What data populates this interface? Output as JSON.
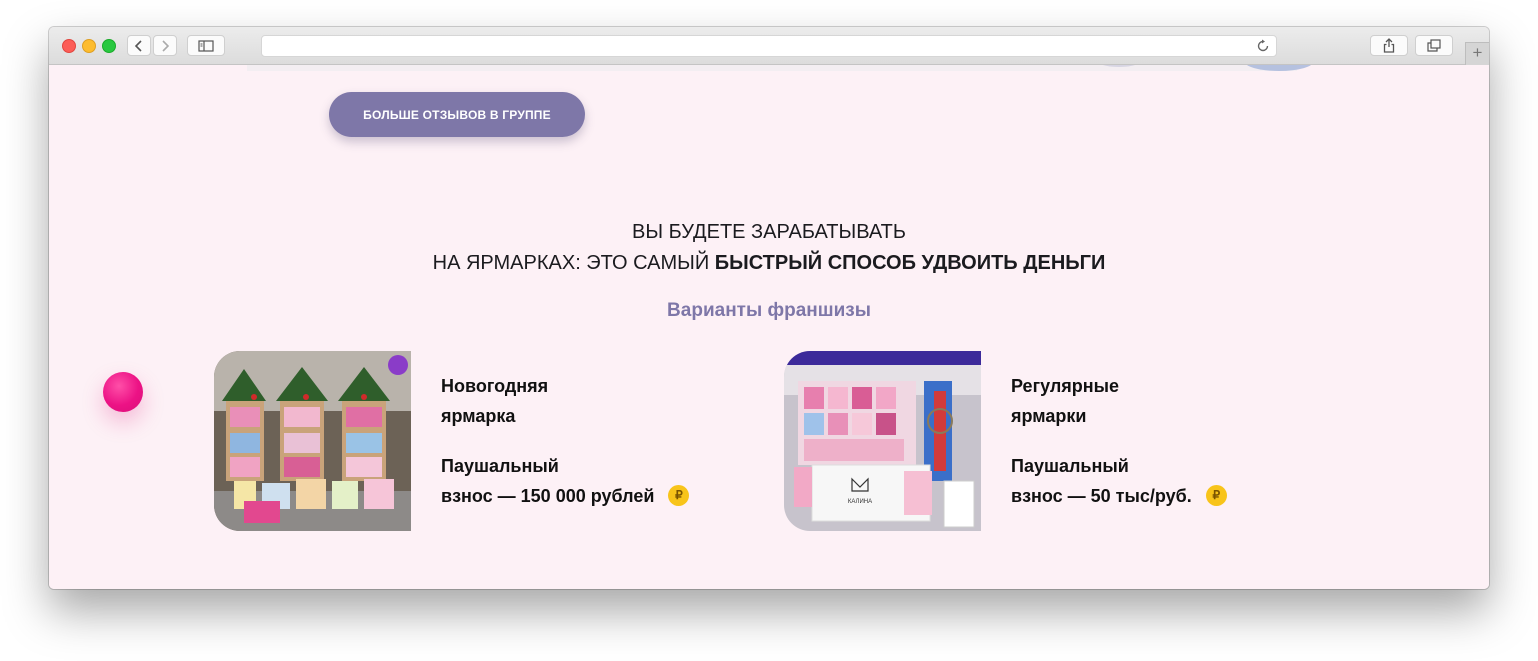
{
  "reviews_button": "БОЛЬШЕ ОТЗЫВОВ В ГРУППЕ",
  "headline": {
    "line1": "ВЫ БУДЕТЕ ЗАРАБАТЫВАТЬ",
    "line2_regular": "НА ЯРМАРКАХ: ЭТО САМЫЙ ",
    "line2_bold": "БЫСТРЫЙ СПОСОБ УДВОИТЬ ДЕНЬГИ"
  },
  "section_title": "Варианты франшизы",
  "cards": [
    {
      "title_line1": "Новогодняя",
      "title_line2": "ярмарка",
      "fee_line1": "Паушальный",
      "fee_line2": "взнос — 150 000 рублей",
      "currency_symbol": "₽"
    },
    {
      "title_line1": "Регулярные",
      "title_line2": "ярмарки",
      "fee_line1": "Паушальный",
      "fee_line2": "взнос — 50 тыс/руб.",
      "currency_symbol": "₽",
      "photo_sign": "КАЛИНА"
    }
  ],
  "colors": {
    "page_background": "#fdf1f6",
    "accent_purple": "#7e77a8",
    "accent_pink": "#ec1285",
    "ruble_badge": "#f8c41a"
  }
}
